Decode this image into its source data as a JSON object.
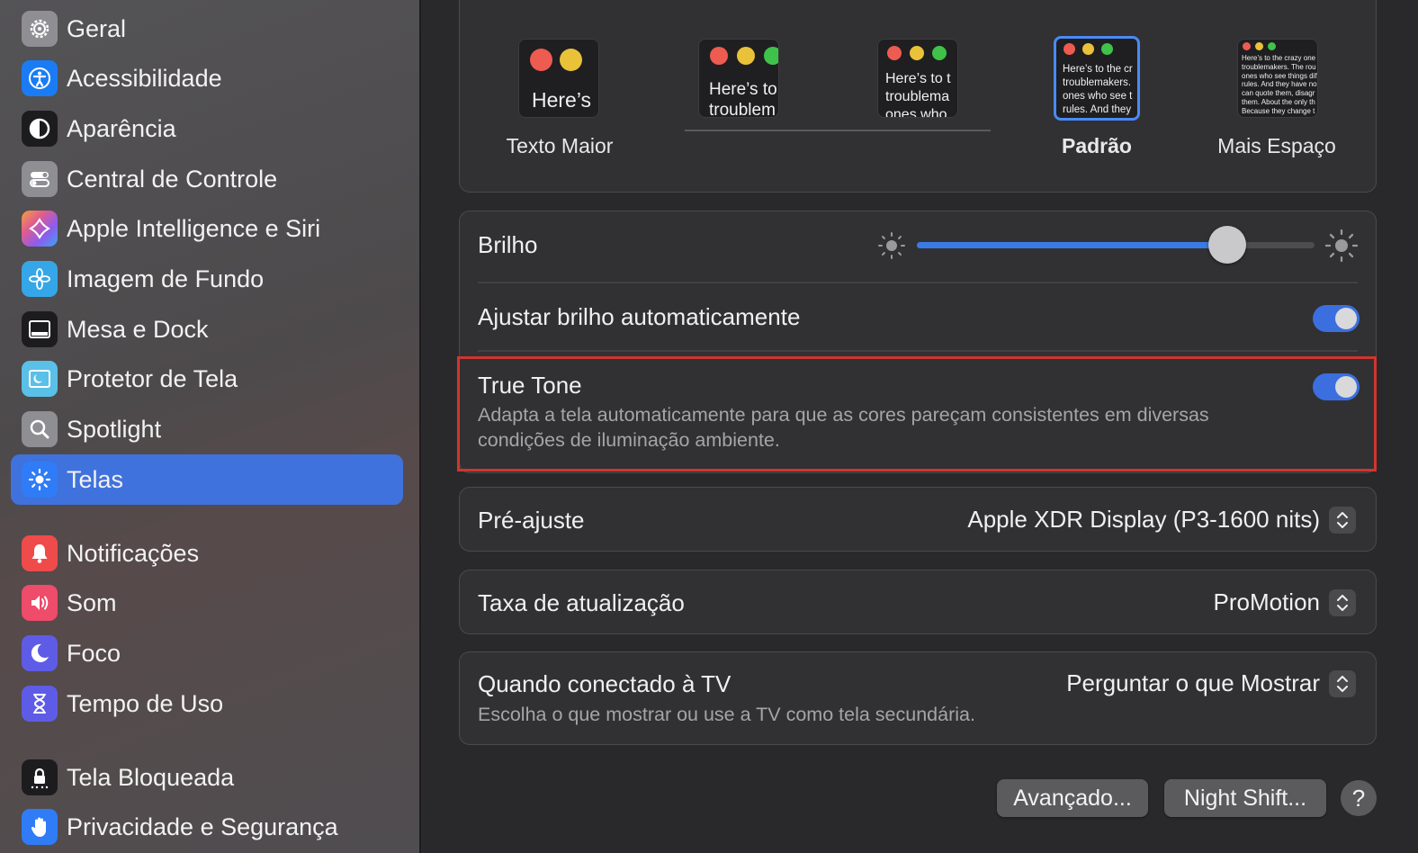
{
  "sidebar": {
    "items": [
      {
        "label": "Geral",
        "icon": "gear-icon",
        "color": "#8e8e93"
      },
      {
        "label": "Acessibilidade",
        "icon": "accessibility-icon",
        "color": "#1a7cf5"
      },
      {
        "label": "Aparência",
        "icon": "appearance-icon",
        "color": "#1c1c1e"
      },
      {
        "label": "Central de Controle",
        "icon": "control-center-icon",
        "color": "#8e8e93"
      },
      {
        "label": "Apple Intelligence e Siri",
        "icon": "siri-icon",
        "color": "#e15c8e"
      },
      {
        "label": "Imagem de Fundo",
        "icon": "wallpaper-icon",
        "color": "#35a7e8"
      },
      {
        "label": "Mesa e Dock",
        "icon": "dock-icon",
        "color": "#1c1c1e"
      },
      {
        "label": "Protetor de Tela",
        "icon": "screensaver-icon",
        "color": "#5ac0e8"
      },
      {
        "label": "Spotlight",
        "icon": "spotlight-icon",
        "color": "#8e8e93"
      },
      {
        "label": "Telas",
        "icon": "displays-icon",
        "color": "#2f7cf6"
      },
      {
        "label": "Notificações",
        "icon": "notifications-icon",
        "color": "#ef4b4b"
      },
      {
        "label": "Som",
        "icon": "sound-icon",
        "color": "#ef4b6a"
      },
      {
        "label": "Foco",
        "icon": "focus-icon",
        "color": "#5e5ce6"
      },
      {
        "label": "Tempo de Uso",
        "icon": "screen-time-icon",
        "color": "#5e5ce6"
      },
      {
        "label": "Tela Bloqueada",
        "icon": "lock-screen-icon",
        "color": "#1c1c1e"
      },
      {
        "label": "Privacidade e Segurança",
        "icon": "privacy-hand-icon",
        "color": "#2f7cf6"
      }
    ],
    "active_index": 9
  },
  "resolution": {
    "options": [
      {
        "label": "Texto Maior",
        "preview": "Here’s"
      },
      {
        "label": "",
        "preview": "Here’s to\ntroublem"
      },
      {
        "label": "",
        "preview": "Here’s to t\ntroublema\nones who"
      },
      {
        "label": "Padrão",
        "preview": "Here’s to the cr\ntroublemakers.\nones who see t\nrules. And they"
      },
      {
        "label": "Mais Espaço",
        "preview": "Here’s to the crazy one\ntroublemakers. The rou\nones who see things dif\nrules. And they have no\ncan quote them, disagr\nthem. About the only th\nBecause they change t"
      }
    ],
    "selected_index": 3
  },
  "brightness": {
    "label": "Brilho",
    "level": 0.78
  },
  "auto_brightness": {
    "label": "Ajustar brilho automaticamente",
    "on": true
  },
  "true_tone": {
    "label": "True Tone",
    "description_line1": "Adapta a tela automaticamente para que as cores pareçam consistentes em diversas",
    "description_line2": "condições de iluminação ambiente.",
    "on": true
  },
  "preset": {
    "label": "Pré-ajuste",
    "value": "Apple XDR Display (P3-1600 nits)"
  },
  "refresh_rate": {
    "label": "Taxa de atualização",
    "value": "ProMotion"
  },
  "tv": {
    "label": "Quando conectado à TV",
    "description": "Escolha o que mostrar ou use a TV como tela secundária.",
    "value": "Perguntar o que Mostrar"
  },
  "buttons": {
    "advanced": "Avançado...",
    "night_shift": "Night Shift...",
    "help": "?"
  },
  "colors": {
    "accent": "#3b6fe0",
    "highlight": "#d0352e"
  }
}
